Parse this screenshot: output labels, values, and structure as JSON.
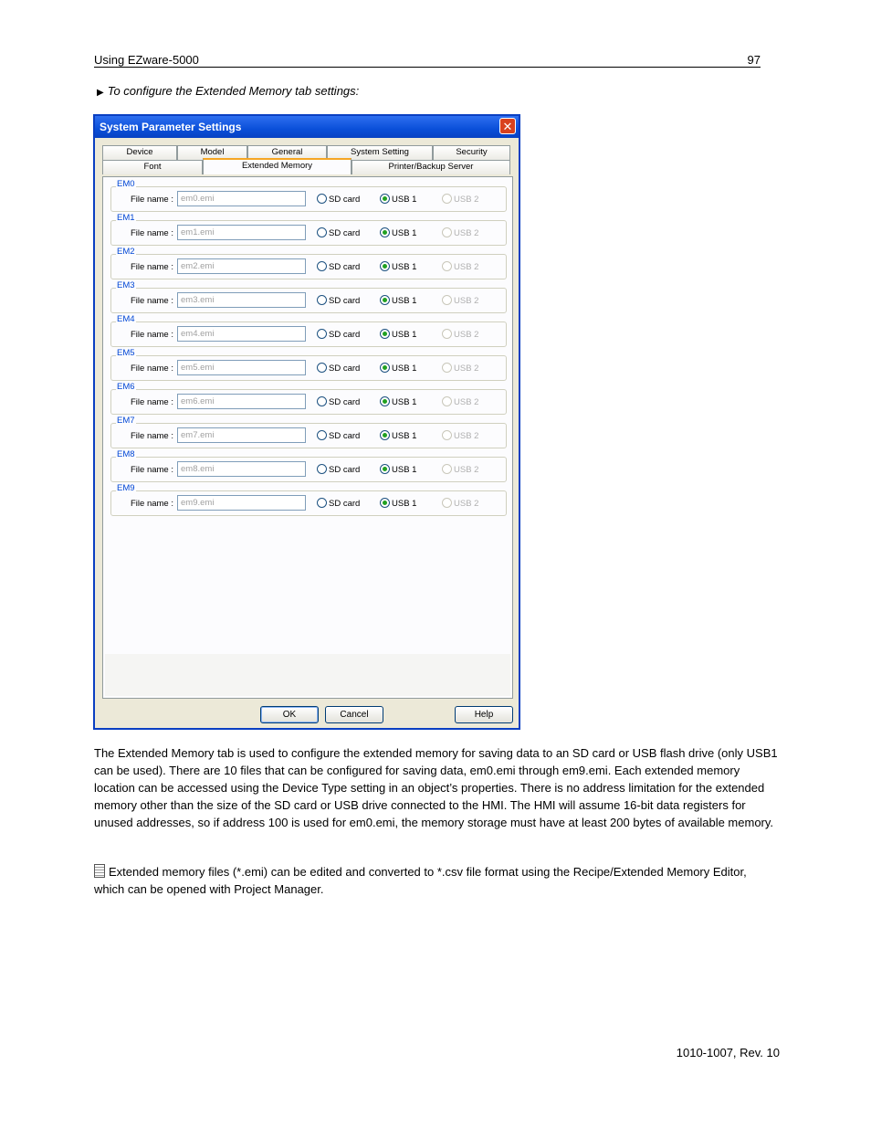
{
  "header": {
    "left": "Using EZware-5000",
    "right": "97"
  },
  "step_intro": "To configure the Extended Memory tab settings:",
  "dialog": {
    "title": "System Parameter Settings",
    "tabs_row1": [
      "Device",
      "Model",
      "General",
      "System Setting",
      "Security"
    ],
    "tabs_row2": [
      "Font",
      "Extended Memory",
      "Printer/Backup Server"
    ],
    "active_tab": "Extended Memory",
    "file_name_label": "File name :",
    "radio_labels": {
      "sd": "SD card",
      "usb1": "USB 1",
      "usb2": "USB 2"
    },
    "groups": [
      {
        "label": "EM0",
        "file": "em0.emi",
        "selected": "USB 1"
      },
      {
        "label": "EM1",
        "file": "em1.emi",
        "selected": "USB 1"
      },
      {
        "label": "EM2",
        "file": "em2.emi",
        "selected": "USB 1"
      },
      {
        "label": "EM3",
        "file": "em3.emi",
        "selected": "USB 1"
      },
      {
        "label": "EM4",
        "file": "em4.emi",
        "selected": "USB 1"
      },
      {
        "label": "EM5",
        "file": "em5.emi",
        "selected": "USB 1"
      },
      {
        "label": "EM6",
        "file": "em6.emi",
        "selected": "USB 1"
      },
      {
        "label": "EM7",
        "file": "em7.emi",
        "selected": "USB 1"
      },
      {
        "label": "EM8",
        "file": "em8.emi",
        "selected": "USB 1"
      },
      {
        "label": "EM9",
        "file": "em9.emi",
        "selected": "USB 1"
      }
    ],
    "buttons": {
      "ok": "OK",
      "cancel": "Cancel",
      "help": "Help"
    }
  },
  "body_paragraph": "The Extended Memory tab is used to configure the extended memory for saving data to an SD card or USB flash drive (only USB1  can be used). There are 10 files that can be configured for saving data, em0.emi through em9.emi. Each extended memory location can be accessed using the Device Type setting in an object’s properties. There is no address limitation for the extended memory other than the size of the SD card or USB drive connected to the HMI. The HMI will assume 16-bit data registers for unused addresses, so if address 100 is used for em0.emi, the memory storage must have at least 200 bytes of available memory.",
  "note": "Extended memory files (*.emi) can be edited and converted to *.csv file format using the Recipe/Extended Memory Editor, which can be opened with Project Manager.",
  "footer": "1010-1007, Rev. 10"
}
